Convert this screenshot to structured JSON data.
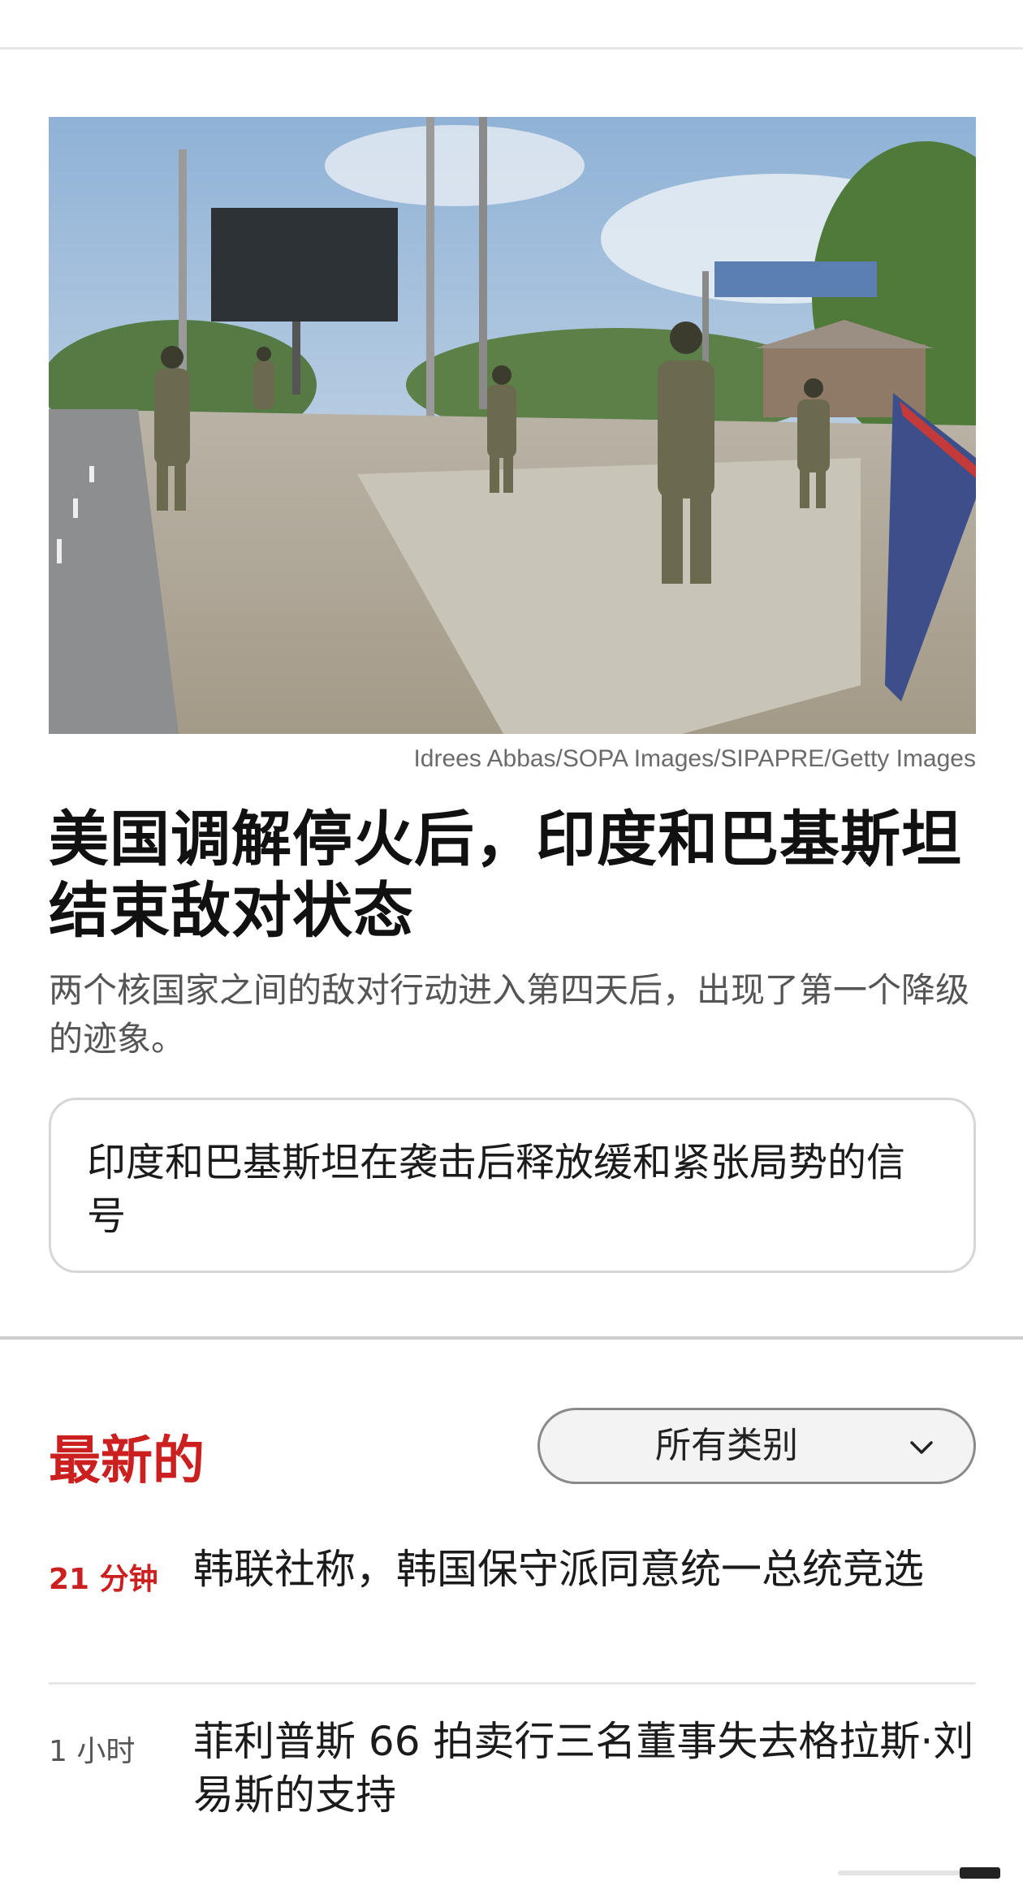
{
  "article": {
    "image_alt": "Soldiers standing guard on a roadside",
    "image_credit": "Idrees Abbas/SOPA Images/SIPAPRE/Getty Images",
    "headline": "美国调解停火后，印度和巴基斯坦结束敌对状态",
    "subheadline": "两个核国家之间的敌对行动进入第四天后，出现了第一个降级的迹象。",
    "related_link": "印度和巴基斯坦在袭击后释放缓和紧张局势的信号"
  },
  "latest": {
    "title": "最新的",
    "filter_label": "所有类别",
    "items": [
      {
        "time": "21 分钟",
        "headline": "韩联社称，韩国保守派同意统一总统竞选"
      },
      {
        "time": "1 小时",
        "headline": "菲利普斯 66 拍卖行三名董事失去格拉斯·刘易斯的支持"
      }
    ]
  },
  "colors": {
    "accent": "#cc1f1f",
    "text": "#1b1b1b",
    "muted": "#555555"
  },
  "icons": {
    "filter_chevron": "chevron-down-icon"
  }
}
